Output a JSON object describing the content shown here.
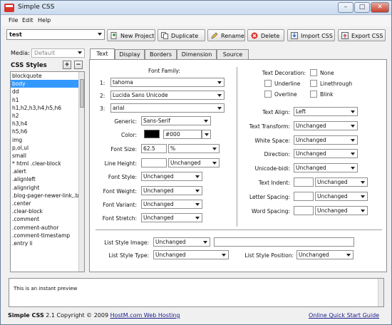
{
  "window": {
    "title": "Simple CSS"
  },
  "menu": [
    "File",
    "Edit",
    "Help"
  ],
  "toolbar": {
    "stylesheet_value": "test",
    "buttons": [
      "New Project",
      "Duplicate",
      "Rename",
      "Delete",
      "Import CSS",
      "Export CSS"
    ]
  },
  "left": {
    "media_label": "Media:",
    "media_value": "Default",
    "styles_label": "CSS Styles",
    "add_label": "+",
    "remove_label": "−",
    "selectors": [
      "blockquote",
      "body",
      "dd",
      "h1",
      "h1,h2,h3,h4,h5,h6",
      "h2",
      "h3,h4",
      "h5,h6",
      "img",
      "p,ol,ul",
      "small",
      "* html .clear-block",
      ".alert",
      ".alignleft",
      ".alignright",
      ".blog-pager-newer-link,.blo",
      ".center",
      ".clear-block",
      ".comment",
      ".comment-author",
      ".comment-timestamp",
      ".entry li"
    ],
    "selected_index": 1
  },
  "tabs": [
    "Text",
    "Display",
    "Borders",
    "Dimension",
    "Source"
  ],
  "active_tab": 0,
  "text_tab": {
    "font_family_label": "Font Family:",
    "family_numbers": [
      "1:",
      "2:",
      "3:"
    ],
    "families": [
      "tahoma",
      "Lucida Sans Unicode",
      "arial"
    ],
    "generic_label": "Generic:",
    "generic_value": "Sans-Serif",
    "color_label": "Color:",
    "color_value": "#000",
    "color_swatch": "#000000",
    "font_size_label": "Font Size:",
    "font_size_value": "62.5",
    "font_size_unit": "%",
    "line_height_label": "Line Height:",
    "line_height_unit": "Unchanged",
    "font_style_label": "Font Style:",
    "font_style_value": "Unchanged",
    "font_weight_label": "Font Weight:",
    "font_weight_value": "Unchanged",
    "font_variant_label": "Font Variant:",
    "font_variant_value": "Unchanged",
    "font_stretch_label": "Font Stretch:",
    "font_stretch_value": "Unchanged",
    "text_decoration_label": "Text Decoration:",
    "decorations": [
      "None",
      "Underline",
      "Linethrough",
      "Overline",
      "Blink"
    ],
    "text_align_label": "Text Align:",
    "text_align_value": "Left",
    "text_transform_label": "Text Transform:",
    "text_transform_value": "Unchanged",
    "white_space_label": "White Space:",
    "white_space_value": "Unchanged",
    "direction_label": "Direction:",
    "direction_value": "Unchanged",
    "unicode_bidi_label": "Unicode-bidi:",
    "unicode_bidi_value": "Unchanged",
    "text_indent_label": "Text Indent:",
    "text_indent_unit": "Unchanged",
    "letter_spacing_label": "Letter Spacing:",
    "letter_spacing_unit": "Unchanged",
    "word_spacing_label": "Word Spacing:",
    "word_spacing_unit": "Unchanged",
    "list_style_image_label": "List Style Image:",
    "list_style_image_value": "Unchanged",
    "list_style_type_label": "List Style Type:",
    "list_style_type_value": "Unchanged",
    "list_style_position_label": "List Style Position:",
    "list_style_position_value": "Unchanged"
  },
  "preview": {
    "text": "This is an instant preview"
  },
  "status": {
    "app_name": "Simple CSS",
    "copyright": " 2.1 Copyright © 2009 ",
    "company_link": "HostM.com Web Hosting",
    "guide_link": "Online Quick Start Guide"
  },
  "colors": {
    "selection": "#3399ff",
    "link": "#1a1a8c",
    "close_button": "#c4402c"
  }
}
